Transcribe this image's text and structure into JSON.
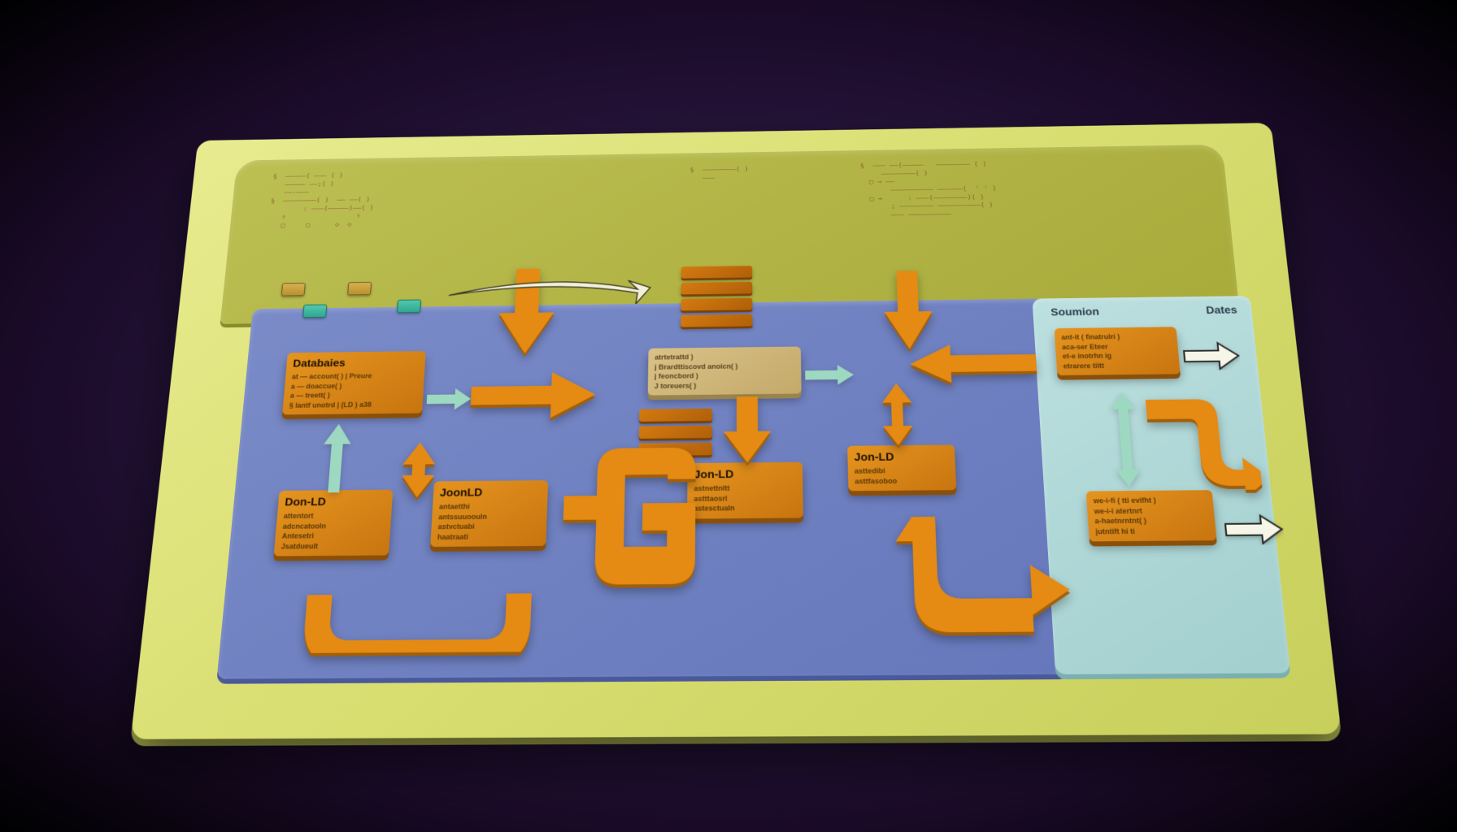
{
  "panels": {
    "session_label": "Soumion",
    "dates_label": "Dates"
  },
  "nodes": {
    "databases": {
      "title": "Databaies"
    },
    "center_box": {
      "line1": "atrtetrattd )",
      "line2": "j Brardttiscovd anoicn( )",
      "line3": "j feoncbord )",
      "line4": "J toreuers( )"
    },
    "don_ld": {
      "title": "Don-LD"
    },
    "joon_ld": {
      "title": "JoonLD"
    },
    "jon_ld_mid": {
      "title": "Jon-LD"
    },
    "jon_ld_right": {
      "title": "Jon-LD"
    }
  }
}
